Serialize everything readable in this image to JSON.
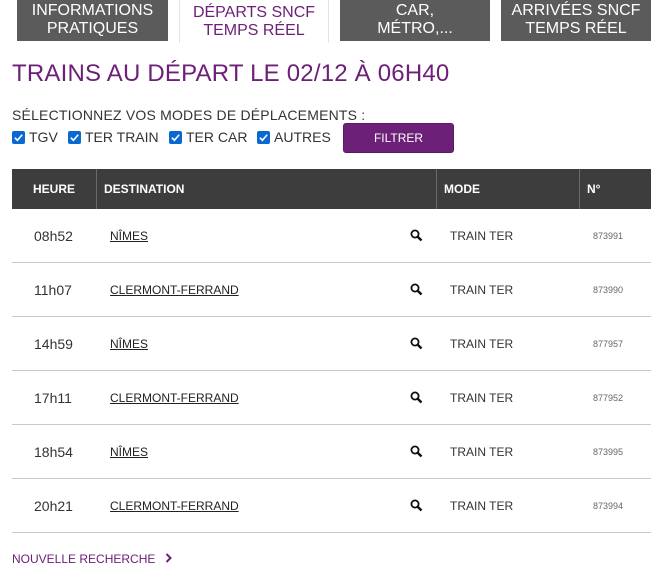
{
  "tabs": [
    {
      "line1": "Informations",
      "line2": "pratiques",
      "active": false
    },
    {
      "line1": "Départs SNCF",
      "line2": "temps réel",
      "active": true
    },
    {
      "line1": "Départs bus, car,",
      "line2": "métro,...",
      "active": false
    },
    {
      "line1": "Arrivées SNCF",
      "line2": "temps réel",
      "active": false
    }
  ],
  "page": {
    "title": "Trains au départ le 02/12 à 06h40",
    "modes_label": "Sélectionnez vos modes de déplacements :"
  },
  "filters": [
    {
      "label": "TGV",
      "checked": true
    },
    {
      "label": "TER train",
      "checked": true
    },
    {
      "label": "TER car",
      "checked": true
    },
    {
      "label": "Autres",
      "checked": true
    }
  ],
  "filter_button": "Filtrer",
  "table": {
    "headers": {
      "time": "Heure",
      "destination": "Destination",
      "mode": "Mode",
      "number": "N°"
    },
    "rows": [
      {
        "time": "08h52",
        "destination": "Nîmes",
        "mode": "Train TER",
        "number": "873991"
      },
      {
        "time": "11h07",
        "destination": "Clermont-Ferrand",
        "mode": "Train TER",
        "number": "873990"
      },
      {
        "time": "14h59",
        "destination": "Nîmes",
        "mode": "Train TER",
        "number": "877957"
      },
      {
        "time": "17h11",
        "destination": "Clermont-Ferrand",
        "mode": "Train TER",
        "number": "877952"
      },
      {
        "time": "18h54",
        "destination": "Nîmes",
        "mode": "Train TER",
        "number": "873995"
      },
      {
        "time": "20h21",
        "destination": "Clermont-Ferrand",
        "mode": "Train TER",
        "number": "873994"
      }
    ]
  },
  "new_search": "Nouvelle recherche",
  "icons": {
    "search": "magnifier-icon",
    "checkbox": "check-icon",
    "chevron": "chevron-right-icon"
  },
  "colors": {
    "accent": "#6d2077",
    "tab_bg": "#5b5b5b",
    "header_bg": "#3d3d3d",
    "checkbox": "#0a69d0"
  }
}
